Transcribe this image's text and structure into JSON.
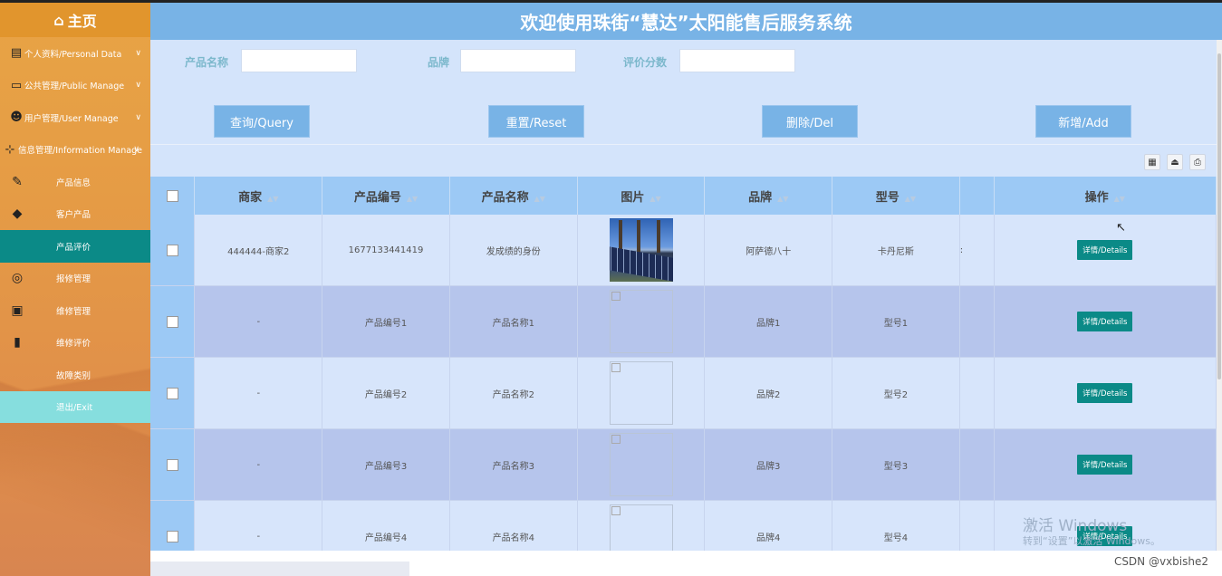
{
  "sidebar": {
    "home_label": "主页",
    "menus": [
      {
        "label": "个人资料/Personal Data",
        "icon": "user-card-icon"
      },
      {
        "label": "公共管理/Public Manage",
        "icon": "monitor-icon"
      },
      {
        "label": "用户管理/User Manage",
        "icon": "user-gear-icon"
      },
      {
        "label": "信息管理/Information Manage",
        "icon": "sitemap-icon"
      }
    ],
    "sub_items": [
      {
        "label": "产品信息",
        "icon": "pencil-tools-icon"
      },
      {
        "label": "客户产品",
        "icon": "tag-icon"
      },
      {
        "label": "产品评价",
        "icon": ""
      },
      {
        "label": "报修管理",
        "icon": "planet-icon"
      },
      {
        "label": "维修管理",
        "icon": "book-icon"
      },
      {
        "label": "维修评价",
        "icon": "door-icon"
      },
      {
        "label": "故障类别",
        "icon": ""
      },
      {
        "label": "退出/Exit",
        "icon": ""
      }
    ],
    "active_item": "产品评价"
  },
  "header": {
    "title": "欢迎使用珠街“慧达”太阳能售后服务系统"
  },
  "search": {
    "fields": [
      {
        "label": "产品名称",
        "value": ""
      },
      {
        "label": "品牌",
        "value": ""
      },
      {
        "label": "评价分数",
        "value": ""
      }
    ]
  },
  "buttons": {
    "query": "查询/Query",
    "reset": "重置/Reset",
    "delete": "删除/Del",
    "add": "新增/Add"
  },
  "table": {
    "columns": [
      "商家",
      "产品编号",
      "产品名称",
      "图片",
      "品牌",
      "型号",
      "",
      "操作"
    ],
    "details_label": "详情/Details",
    "rows": [
      {
        "merchant": "444444-商家2",
        "product_no": "1677133441419",
        "product_name": "发成绩的身份",
        "brand": "阿萨德八十",
        "model": "卡丹尼斯",
        "extra": ":"
      },
      {
        "merchant": "-",
        "product_no": "产品编号1",
        "product_name": "产品名称1",
        "brand": "品牌1",
        "model": "型号1",
        "extra": ""
      },
      {
        "merchant": "-",
        "product_no": "产品编号2",
        "product_name": "产品名称2",
        "brand": "品牌2",
        "model": "型号2",
        "extra": ""
      },
      {
        "merchant": "-",
        "product_no": "产品编号3",
        "product_name": "产品名称3",
        "brand": "品牌3",
        "model": "型号3",
        "extra": ""
      },
      {
        "merchant": "-",
        "product_no": "产品编号4",
        "product_name": "产品名称4",
        "brand": "品牌4",
        "model": "型号4",
        "extra": ""
      }
    ]
  },
  "watermark": {
    "line1": "激活 Windows",
    "line2": "转到“设置”以激活 Windows。"
  },
  "csdn": "CSDN @vxbishe2",
  "colors": {
    "sidebar": "#e59b45",
    "header": "#78b3e6",
    "active": "#0b8a87",
    "details_button": "#0b8a87"
  }
}
